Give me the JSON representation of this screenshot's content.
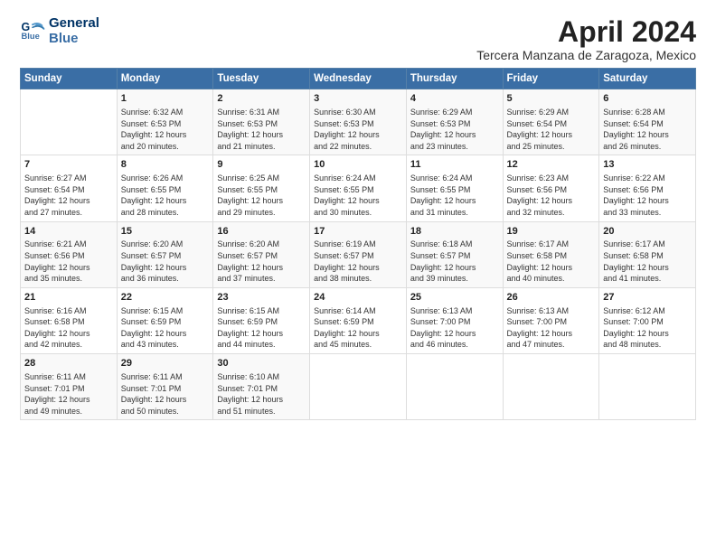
{
  "logo": {
    "line1": "General",
    "line2": "Blue"
  },
  "title": "April 2024",
  "location": "Tercera Manzana de Zaragoza, Mexico",
  "header": {
    "days": [
      "Sunday",
      "Monday",
      "Tuesday",
      "Wednesday",
      "Thursday",
      "Friday",
      "Saturday"
    ]
  },
  "weeks": [
    [
      {
        "num": "",
        "info": ""
      },
      {
        "num": "1",
        "info": "Sunrise: 6:32 AM\nSunset: 6:53 PM\nDaylight: 12 hours\nand 20 minutes."
      },
      {
        "num": "2",
        "info": "Sunrise: 6:31 AM\nSunset: 6:53 PM\nDaylight: 12 hours\nand 21 minutes."
      },
      {
        "num": "3",
        "info": "Sunrise: 6:30 AM\nSunset: 6:53 PM\nDaylight: 12 hours\nand 22 minutes."
      },
      {
        "num": "4",
        "info": "Sunrise: 6:29 AM\nSunset: 6:53 PM\nDaylight: 12 hours\nand 23 minutes."
      },
      {
        "num": "5",
        "info": "Sunrise: 6:29 AM\nSunset: 6:54 PM\nDaylight: 12 hours\nand 25 minutes."
      },
      {
        "num": "6",
        "info": "Sunrise: 6:28 AM\nSunset: 6:54 PM\nDaylight: 12 hours\nand 26 minutes."
      }
    ],
    [
      {
        "num": "7",
        "info": "Sunrise: 6:27 AM\nSunset: 6:54 PM\nDaylight: 12 hours\nand 27 minutes."
      },
      {
        "num": "8",
        "info": "Sunrise: 6:26 AM\nSunset: 6:55 PM\nDaylight: 12 hours\nand 28 minutes."
      },
      {
        "num": "9",
        "info": "Sunrise: 6:25 AM\nSunset: 6:55 PM\nDaylight: 12 hours\nand 29 minutes."
      },
      {
        "num": "10",
        "info": "Sunrise: 6:24 AM\nSunset: 6:55 PM\nDaylight: 12 hours\nand 30 minutes."
      },
      {
        "num": "11",
        "info": "Sunrise: 6:24 AM\nSunset: 6:55 PM\nDaylight: 12 hours\nand 31 minutes."
      },
      {
        "num": "12",
        "info": "Sunrise: 6:23 AM\nSunset: 6:56 PM\nDaylight: 12 hours\nand 32 minutes."
      },
      {
        "num": "13",
        "info": "Sunrise: 6:22 AM\nSunset: 6:56 PM\nDaylight: 12 hours\nand 33 minutes."
      }
    ],
    [
      {
        "num": "14",
        "info": "Sunrise: 6:21 AM\nSunset: 6:56 PM\nDaylight: 12 hours\nand 35 minutes."
      },
      {
        "num": "15",
        "info": "Sunrise: 6:20 AM\nSunset: 6:57 PM\nDaylight: 12 hours\nand 36 minutes."
      },
      {
        "num": "16",
        "info": "Sunrise: 6:20 AM\nSunset: 6:57 PM\nDaylight: 12 hours\nand 37 minutes."
      },
      {
        "num": "17",
        "info": "Sunrise: 6:19 AM\nSunset: 6:57 PM\nDaylight: 12 hours\nand 38 minutes."
      },
      {
        "num": "18",
        "info": "Sunrise: 6:18 AM\nSunset: 6:57 PM\nDaylight: 12 hours\nand 39 minutes."
      },
      {
        "num": "19",
        "info": "Sunrise: 6:17 AM\nSunset: 6:58 PM\nDaylight: 12 hours\nand 40 minutes."
      },
      {
        "num": "20",
        "info": "Sunrise: 6:17 AM\nSunset: 6:58 PM\nDaylight: 12 hours\nand 41 minutes."
      }
    ],
    [
      {
        "num": "21",
        "info": "Sunrise: 6:16 AM\nSunset: 6:58 PM\nDaylight: 12 hours\nand 42 minutes."
      },
      {
        "num": "22",
        "info": "Sunrise: 6:15 AM\nSunset: 6:59 PM\nDaylight: 12 hours\nand 43 minutes."
      },
      {
        "num": "23",
        "info": "Sunrise: 6:15 AM\nSunset: 6:59 PM\nDaylight: 12 hours\nand 44 minutes."
      },
      {
        "num": "24",
        "info": "Sunrise: 6:14 AM\nSunset: 6:59 PM\nDaylight: 12 hours\nand 45 minutes."
      },
      {
        "num": "25",
        "info": "Sunrise: 6:13 AM\nSunset: 7:00 PM\nDaylight: 12 hours\nand 46 minutes."
      },
      {
        "num": "26",
        "info": "Sunrise: 6:13 AM\nSunset: 7:00 PM\nDaylight: 12 hours\nand 47 minutes."
      },
      {
        "num": "27",
        "info": "Sunrise: 6:12 AM\nSunset: 7:00 PM\nDaylight: 12 hours\nand 48 minutes."
      }
    ],
    [
      {
        "num": "28",
        "info": "Sunrise: 6:11 AM\nSunset: 7:01 PM\nDaylight: 12 hours\nand 49 minutes."
      },
      {
        "num": "29",
        "info": "Sunrise: 6:11 AM\nSunset: 7:01 PM\nDaylight: 12 hours\nand 50 minutes."
      },
      {
        "num": "30",
        "info": "Sunrise: 6:10 AM\nSunset: 7:01 PM\nDaylight: 12 hours\nand 51 minutes."
      },
      {
        "num": "",
        "info": ""
      },
      {
        "num": "",
        "info": ""
      },
      {
        "num": "",
        "info": ""
      },
      {
        "num": "",
        "info": ""
      }
    ]
  ]
}
